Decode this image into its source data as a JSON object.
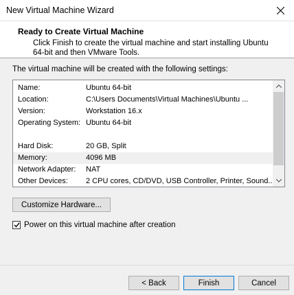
{
  "window": {
    "title": "New Virtual Machine Wizard"
  },
  "header": {
    "title": "Ready to Create Virtual Machine",
    "description": "Click Finish to create the virtual machine and start installing Ubuntu 64-bit and then VMware Tools."
  },
  "intro": "The virtual machine will be created with the following settings:",
  "settings": [
    {
      "key": "Name:",
      "value": "Ubuntu 64-bit"
    },
    {
      "key": "Location:",
      "value": "C:\\Users          Documents\\Virtual Machines\\Ubuntu ..."
    },
    {
      "key": "Version:",
      "value": "Workstation 16.x"
    },
    {
      "key": "Operating System:",
      "value": "Ubuntu 64-bit"
    },
    {
      "key": "",
      "value": ""
    },
    {
      "key": "Hard Disk:",
      "value": "20 GB, Split"
    },
    {
      "key": "Memory:",
      "value": "4096 MB"
    },
    {
      "key": "Network Adapter:",
      "value": "NAT"
    },
    {
      "key": "Other Devices:",
      "value": "2 CPU cores, CD/DVD, USB Controller, Printer, Sound..."
    }
  ],
  "customize_button": "Customize Hardware...",
  "power_on": {
    "label": "Power on this virtual machine after creation",
    "checked": true
  },
  "buttons": {
    "back": "< Back",
    "finish": "Finish",
    "cancel": "Cancel"
  }
}
